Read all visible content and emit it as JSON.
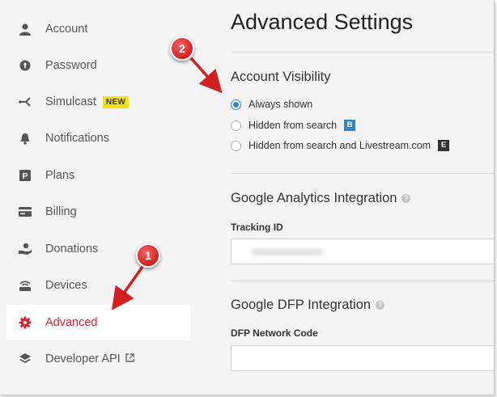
{
  "sidebar": {
    "items": [
      {
        "label": "Account",
        "icon": "person-icon"
      },
      {
        "label": "Password",
        "icon": "lock-icon"
      },
      {
        "label": "Simulcast",
        "icon": "simulcast-icon",
        "badge": "NEW"
      },
      {
        "label": "Notifications",
        "icon": "bell-icon"
      },
      {
        "label": "Plans",
        "icon": "plans-icon"
      },
      {
        "label": "Billing",
        "icon": "card-icon"
      },
      {
        "label": "Donations",
        "icon": "donation-hand-icon"
      },
      {
        "label": "Devices",
        "icon": "device-icon"
      },
      {
        "label": "Advanced",
        "icon": "gear-icon",
        "active": true
      },
      {
        "label": "Developer API",
        "icon": "layers-icon",
        "external": true
      }
    ]
  },
  "main": {
    "title": "Advanced Settings",
    "visibility": {
      "title": "Account Visibility",
      "options": [
        {
          "label": "Always shown",
          "checked": true
        },
        {
          "label": "Hidden from search",
          "tag": "B",
          "checked": false
        },
        {
          "label": "Hidden from search and Livestream.com",
          "tag": "E",
          "checked": false
        }
      ]
    },
    "analytics": {
      "title": "Google Analytics Integration",
      "field_label": "Tracking ID",
      "help": "?"
    },
    "dfp": {
      "title": "Google DFP Integration",
      "field_label": "DFP Network Code",
      "help": "?"
    }
  },
  "annotations": {
    "marker1": "1",
    "marker2": "2",
    "color": "#d41f1f"
  },
  "colors": {
    "accent": "#d9232e",
    "radio": "#3b84c4",
    "background": "#f4f4f4"
  }
}
